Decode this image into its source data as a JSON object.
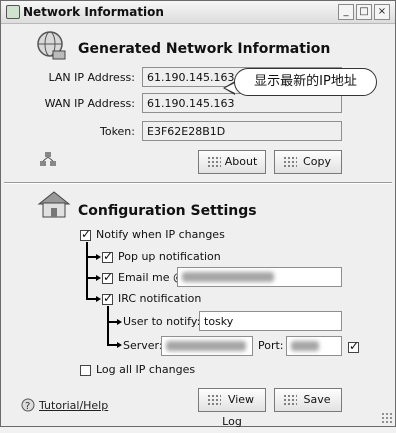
{
  "window": {
    "title": "Network Information",
    "minimize": "_",
    "maximize": "□",
    "close": "×"
  },
  "network": {
    "heading": "Generated Network Information",
    "lan_label": "LAN IP Address:",
    "lan_value": "61.190.145.163",
    "wan_label": "WAN IP Address:",
    "wan_value": "61.190.145.163",
    "token_label": "Token:",
    "token_value": "E3F62E28B1D",
    "about_label": "About",
    "copy_label": "Copy",
    "callout": "显示最新的IP地址"
  },
  "config": {
    "heading": "Configuration Settings",
    "notify_label": "Notify when IP changes",
    "notify_checked": true,
    "popup_label": "Pop up notification",
    "popup_checked": true,
    "email_label": "Email me @",
    "email_checked": true,
    "irc_label": "IRC notification",
    "irc_checked": true,
    "user_label": "User to notify:",
    "user_value": "tosky",
    "server_label": "Server:",
    "port_label": "Port:",
    "port_checked": true,
    "log_label": "Log all IP changes",
    "log_checked": false,
    "viewlog_label": "View Log",
    "save_label": "Save",
    "tutorial_label": "Tutorial/Help"
  }
}
